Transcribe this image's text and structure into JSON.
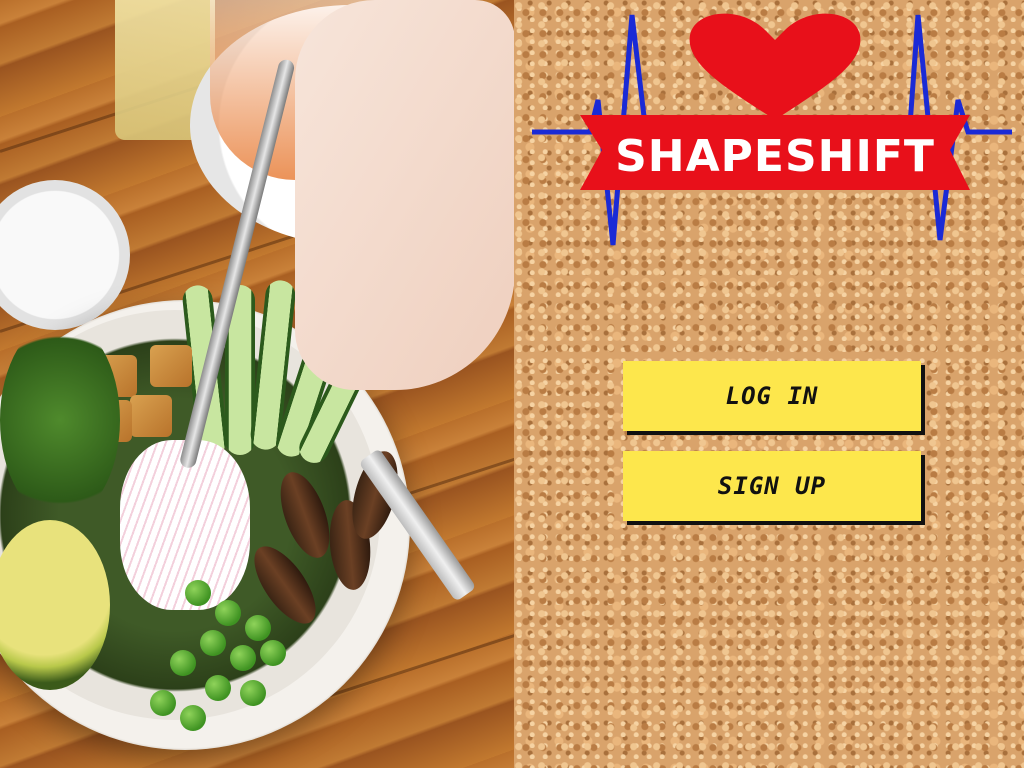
{
  "brand": {
    "name": "SHAPESHIFT",
    "heart_color": "#e8101a",
    "banner_color": "#e8101a",
    "pulse_color": "#1a2ad6"
  },
  "actions": {
    "login_label": "LOG IN",
    "signup_label": "SIGN UP",
    "button_color": "#fde74c"
  },
  "hero_image": {
    "icon": "food-bowl-photo"
  },
  "background": {
    "icon": "cork-board-texture"
  }
}
